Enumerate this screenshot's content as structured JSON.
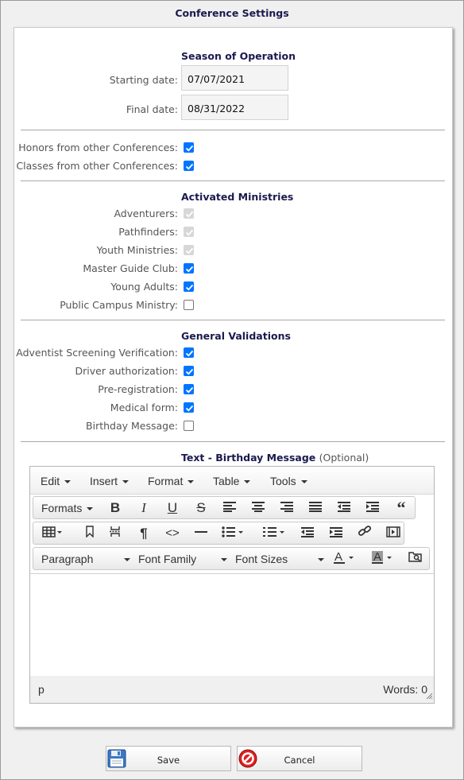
{
  "window": {
    "title": "Conference Settings"
  },
  "season": {
    "title": "Season of Operation",
    "starting_label": "Starting date:",
    "starting_value": "07/07/2021",
    "final_label": "Final date:",
    "final_value": "08/31/2022"
  },
  "options": [
    {
      "label": "Honors from other Conferences:",
      "checked": true,
      "disabled": false
    },
    {
      "label": "Classes from other Conferences:",
      "checked": true,
      "disabled": false
    }
  ],
  "ministries": {
    "title": "Activated Ministries",
    "items": [
      {
        "label": "Adventurers:",
        "checked": true,
        "disabled": true
      },
      {
        "label": "Pathfinders:",
        "checked": true,
        "disabled": true
      },
      {
        "label": "Youth Ministries:",
        "checked": true,
        "disabled": true
      },
      {
        "label": "Master Guide Club:",
        "checked": true,
        "disabled": false
      },
      {
        "label": "Young Adults:",
        "checked": true,
        "disabled": false
      },
      {
        "label": "Public Campus Ministry:",
        "checked": false,
        "disabled": false
      }
    ]
  },
  "validations": {
    "title": "General Validations",
    "items": [
      {
        "label": "Adventist Screening Verification:",
        "checked": true,
        "disabled": false
      },
      {
        "label": "Driver authorization:",
        "checked": true,
        "disabled": false
      },
      {
        "label": "Pre-registration:",
        "checked": true,
        "disabled": false
      },
      {
        "label": "Medical form:",
        "checked": true,
        "disabled": false
      },
      {
        "label": "Birthday Message:",
        "checked": false,
        "disabled": false
      }
    ]
  },
  "birthday_text": {
    "title": "Text - Birthday Message",
    "optional": "(Optional)"
  },
  "editor": {
    "menus": [
      "Edit",
      "Insert",
      "Format",
      "Table",
      "Tools"
    ],
    "formats_label": "Formats",
    "paragraph_label": "Paragraph",
    "font_family_label": "Font Family",
    "font_sizes_label": "Font Sizes",
    "status_path": "p",
    "word_count": "Words: 0"
  },
  "buttons": {
    "save": "Save",
    "cancel": "Cancel"
  },
  "colors": {
    "accent": "#0075ff",
    "heading": "#1a1a4e",
    "cancel_icon": "#e02020",
    "save_icon": "#3a78c2"
  }
}
